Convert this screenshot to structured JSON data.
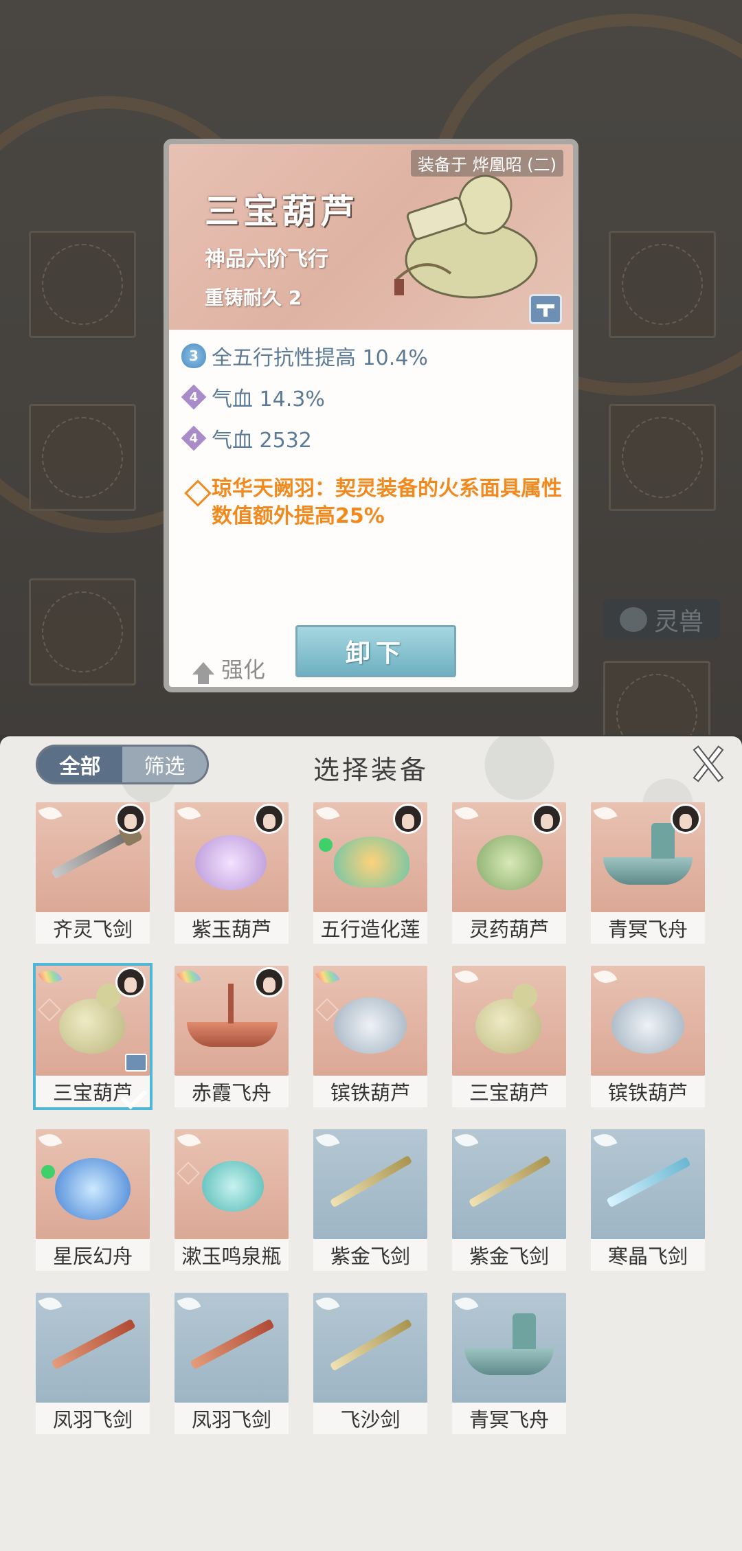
{
  "background": {
    "side_label": "灵兽"
  },
  "detail": {
    "equipped_on": "装备于 烨凰昭 (二)",
    "title": "三宝葫芦",
    "subtitle": "神品六阶飞行",
    "recast": "重铸耐久 2",
    "stats": [
      {
        "badge": "3",
        "badge_color": "blue",
        "text": "全五行抗性提高 10.4%"
      },
      {
        "badge": "4",
        "badge_color": "purple",
        "text": "气血 14.3%"
      },
      {
        "badge": "4",
        "badge_color": "purple",
        "text": "气血 2532"
      }
    ],
    "special": "琼华天阙羽：契灵装备的火系面具属性数值额外提高25%",
    "enhance_label": "强化",
    "unequip_label": "卸下"
  },
  "panel": {
    "tab_all": "全部",
    "tab_filter": "筛选",
    "title": "选择装备",
    "items": [
      {
        "name": "齐灵飞剑",
        "tone": "warm",
        "art": "sword",
        "avatar": true
      },
      {
        "name": "紫玉葫芦",
        "tone": "warm",
        "art": "purpleg",
        "avatar": true
      },
      {
        "name": "五行造化莲",
        "tone": "warm",
        "art": "lotus",
        "avatar": true
      },
      {
        "name": "灵药葫芦",
        "tone": "warm",
        "art": "greeng",
        "avatar": true
      },
      {
        "name": "青冥飞舟",
        "tone": "warm",
        "art": "boat",
        "avatar": true
      },
      {
        "name": "三宝葫芦",
        "tone": "warm",
        "art": "gourd",
        "avatar": true,
        "selected": true
      },
      {
        "name": "赤霞飞舟",
        "tone": "warm",
        "art": "redboat",
        "avatar": true
      },
      {
        "name": "镔铁葫芦",
        "tone": "warm",
        "art": "steelg"
      },
      {
        "name": "三宝葫芦",
        "tone": "warm",
        "art": "gourd"
      },
      {
        "name": "镔铁葫芦",
        "tone": "warm",
        "art": "steelg"
      },
      {
        "name": "星辰幻舟",
        "tone": "warm",
        "art": "orb"
      },
      {
        "name": "漱玉鸣泉瓶",
        "tone": "warm",
        "art": "bottle"
      },
      {
        "name": "紫金飞剑",
        "tone": "cool",
        "art": "goldsword"
      },
      {
        "name": "紫金飞剑",
        "tone": "cool",
        "art": "goldsword"
      },
      {
        "name": "寒晶飞剑",
        "tone": "cool",
        "art": "icesword"
      },
      {
        "name": "凤羽飞剑",
        "tone": "cool",
        "art": "redsword"
      },
      {
        "name": "凤羽飞剑",
        "tone": "cool",
        "art": "redsword"
      },
      {
        "name": "飞沙剑",
        "tone": "cool",
        "art": "goldsword"
      },
      {
        "name": "青冥飞舟",
        "tone": "cool",
        "art": "boat"
      }
    ]
  },
  "colors": {
    "accent_orange": "#f08a1e",
    "stat_blue": "#5b7a96",
    "selected_outline": "#4fb7d6"
  }
}
